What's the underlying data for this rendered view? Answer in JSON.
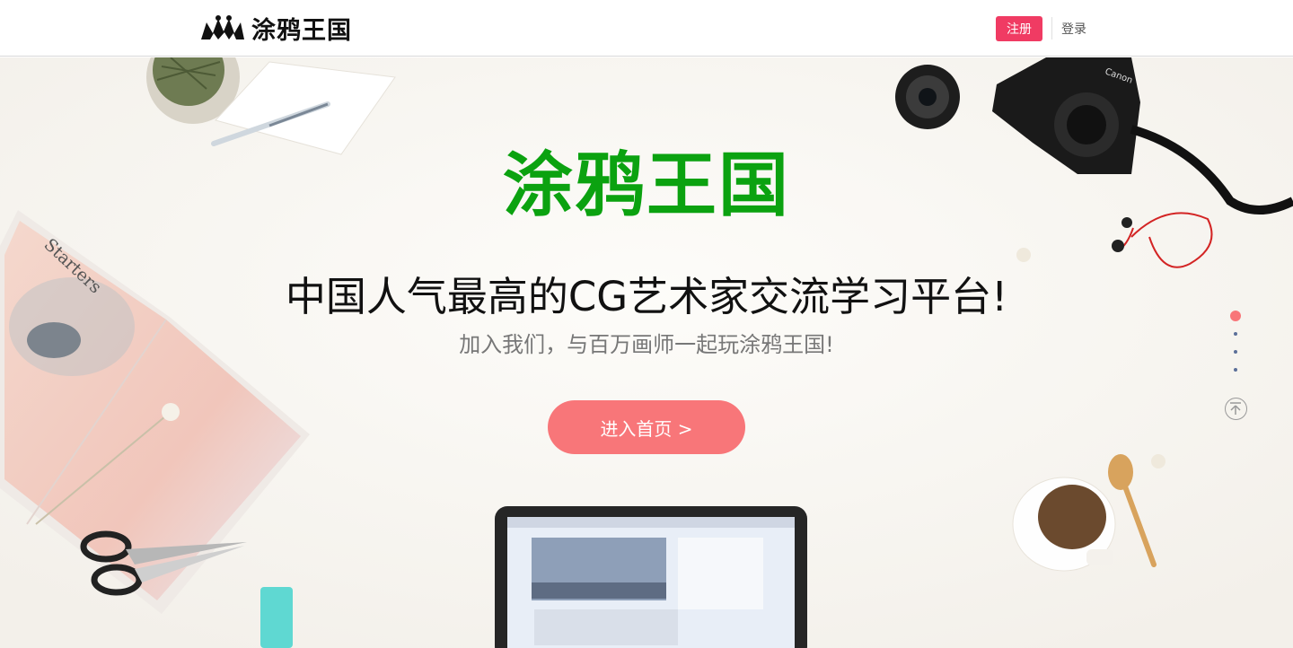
{
  "header": {
    "logo_text": "涂鸦王国",
    "register_label": "注册",
    "login_label": "登录"
  },
  "hero": {
    "title": "涂鸦王国",
    "slogan": "中国人气最高的CG艺术家交流学习平台!",
    "subtitle": "加入我们，与百万画师一起玩涂鸦王国!",
    "cta_label": "进入首页 >",
    "book_cover_text": "Starters",
    "camera_brand": "Canon"
  },
  "carousel": {
    "slides": 4,
    "active_index": 0
  },
  "colors": {
    "accent": "#f03b63",
    "cta": "#f87679",
    "title_green": "#0ba210",
    "dots": "#5b6f99"
  },
  "icons": {
    "logo": "crown-mountain-logo-icon",
    "back_to_top": "arrow-up-circle-icon"
  }
}
